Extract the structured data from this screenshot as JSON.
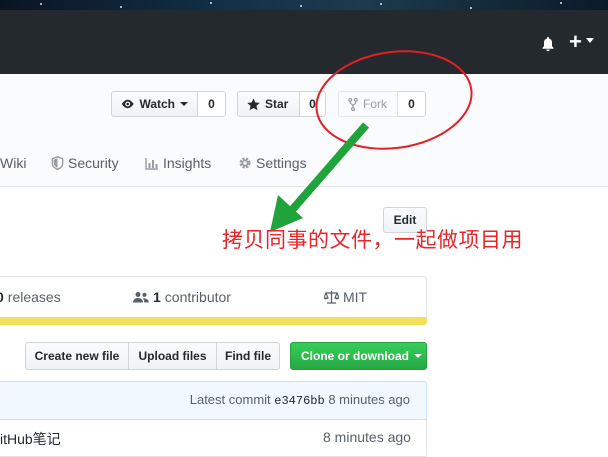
{
  "header": {
    "bell_icon": "bell-icon",
    "plus_label": "+"
  },
  "repo_actions": {
    "watch": {
      "label": "Watch",
      "count": "0",
      "icon": "eye-icon"
    },
    "star": {
      "label": "Star",
      "count": "0",
      "icon": "star-icon"
    },
    "fork": {
      "label": "Fork",
      "count": "0",
      "icon": "fork-icon"
    }
  },
  "tabs": [
    {
      "label": "Wiki",
      "icon": "book-icon"
    },
    {
      "label": "Security",
      "icon": "shield-icon"
    },
    {
      "label": "Insights",
      "icon": "graph-icon"
    },
    {
      "label": "Settings",
      "icon": "gear-icon"
    }
  ],
  "edit_label": "Edit",
  "annotation": {
    "text": "拷贝同事的文件，一起做项目用",
    "color": "#e8252a"
  },
  "stats": {
    "releases_count": "0",
    "releases_label": "releases",
    "contributors_count": "1",
    "contributors_label": "contributor",
    "license": "MIT"
  },
  "file_actions": {
    "create": "Create new file",
    "upload": "Upload files",
    "find": "Find file",
    "clone": "Clone or download"
  },
  "commit": {
    "prefix": "Latest commit",
    "hash": "e3476bb",
    "age": "8 minutes ago"
  },
  "files": [
    {
      "name": "itHub笔记",
      "age": "8 minutes ago"
    }
  ],
  "colors": {
    "header_bg": "#24292e",
    "clone_green": "#28a745",
    "language_bar": "#f1e05a",
    "annotation_red": "#e8252a",
    "arrow_green": "#1fa33a"
  }
}
